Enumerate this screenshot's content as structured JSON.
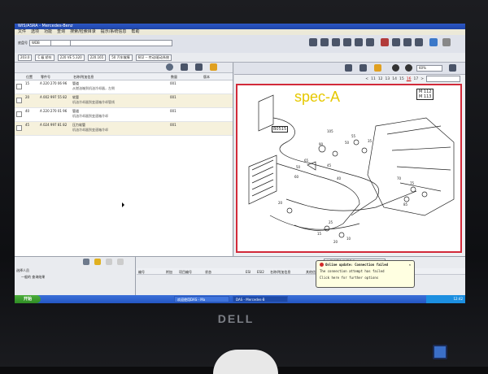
{
  "window": {
    "title": "WIS/ASRA - Mercedes-Benz"
  },
  "menu": [
    "文件",
    "选项",
    "功能",
    "查询",
    "搜索/检索目录",
    "提示/系统信息",
    "帮助"
  ],
  "toolbar": {
    "model_label": "底盘号",
    "model_value": "WDB",
    "filters": [
      "203.0",
      "C 级 轿车",
      "220 VE 5.320",
      "220.165",
      "50 汽车故障",
      "602 -- 传动/驱动系统"
    ]
  },
  "parts_table": {
    "headers": [
      "位置",
      "零件号",
      "名称/附加信息",
      "数量",
      "版本"
    ],
    "rows": [
      {
        "pos": "15",
        "part": "A 220 270 06 96",
        "name": "管道",
        "note": "从燃油箱到机油冷却器，左侧",
        "qty": "001",
        "selected": false
      },
      {
        "pos": "20",
        "part": "A 002 997 55 82",
        "name": "软管",
        "note": "机油冷却器到变速箱冷却管线",
        "qty": "001",
        "selected": true
      },
      {
        "pos": "40",
        "part": "A 220 270 01 96",
        "name": "管道",
        "note": "机油冷却器到变速箱冷却",
        "qty": "001",
        "selected": false
      },
      {
        "pos": "45",
        "part": "A 024 997 81 82",
        "name": "压力软管",
        "note": "机油冷却器到变速箱冷却",
        "qty": "001",
        "selected": true
      }
    ]
  },
  "diagram": {
    "label": "spec-A",
    "ref": "B0515",
    "models": [
      "M 112",
      "M 113"
    ],
    "pages": [
      "<",
      "11",
      "12",
      "13",
      "14",
      "15",
      "16",
      "17",
      ">"
    ],
    "current_page": "16",
    "zoom": "60%",
    "callouts": [
      "105",
      "90",
      "55",
      "50",
      "65",
      "45",
      "35",
      "50",
      "60",
      "40",
      "70",
      "75",
      "85",
      "25",
      "15",
      "20",
      "10",
      "20"
    ]
  },
  "bottom": {
    "left_title": "选择人员",
    "left_item": "一般的 查询结果",
    "right_headers": [
      "编号",
      "附加",
      "项目编号",
      "状态",
      "ESI",
      "ESI2",
      "名称/附加信息",
      "其他信息"
    ],
    "dropdown": "启用搜索和选择条件"
  },
  "taskbar": {
    "start": "开始",
    "tasks": [
      "欢迎使用DAS - Ma",
      "DAS - Mercedes-B"
    ],
    "clock": "12:42"
  },
  "notification": {
    "title": "Online update: Connection failed",
    "line1": "The connection attempt has failed",
    "line2": "Click here for further options"
  },
  "brand": "DELL",
  "colors": {
    "accent": "#d22a3a",
    "title_blue": "#2c57c4",
    "spec_label": "#e6c800"
  }
}
